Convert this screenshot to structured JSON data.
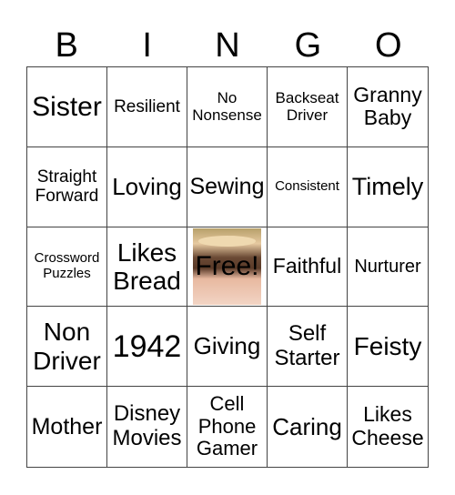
{
  "header": [
    "B",
    "I",
    "N",
    "G",
    "O"
  ],
  "cells": [
    {
      "text": "Sister",
      "size": 30
    },
    {
      "text": "Resilient",
      "size": 19
    },
    {
      "text": "No\nNonsense",
      "size": 17
    },
    {
      "text": "Backseat\nDriver",
      "size": 17
    },
    {
      "text": "Granny\nBaby",
      "size": 23
    },
    {
      "text": "Straight\nForward",
      "size": 19
    },
    {
      "text": "Loving",
      "size": 26
    },
    {
      "text": "Sewing",
      "size": 25
    },
    {
      "text": "Consistent",
      "size": 15
    },
    {
      "text": "Timely",
      "size": 27
    },
    {
      "text": "Crossword\nPuzzles",
      "size": 15
    },
    {
      "text": "Likes\nBread",
      "size": 28
    },
    {
      "text": "Free!",
      "free": true,
      "image": "photo of smiling woman in a straw hat"
    },
    {
      "text": "Faithful",
      "size": 23
    },
    {
      "text": "Nurturer",
      "size": 20
    },
    {
      "text": "Non\nDriver",
      "size": 28
    },
    {
      "text": "1942",
      "size": 34
    },
    {
      "text": "Giving",
      "size": 26
    },
    {
      "text": "Self\nStarter",
      "size": 24
    },
    {
      "text": "Feisty",
      "size": 28
    },
    {
      "text": "Mother",
      "size": 25
    },
    {
      "text": "Disney\nMovies",
      "size": 24
    },
    {
      "text": "Cell\nPhone\nGamer",
      "size": 22
    },
    {
      "text": "Caring",
      "size": 26
    },
    {
      "text": "Likes\nCheese",
      "size": 23
    }
  ]
}
